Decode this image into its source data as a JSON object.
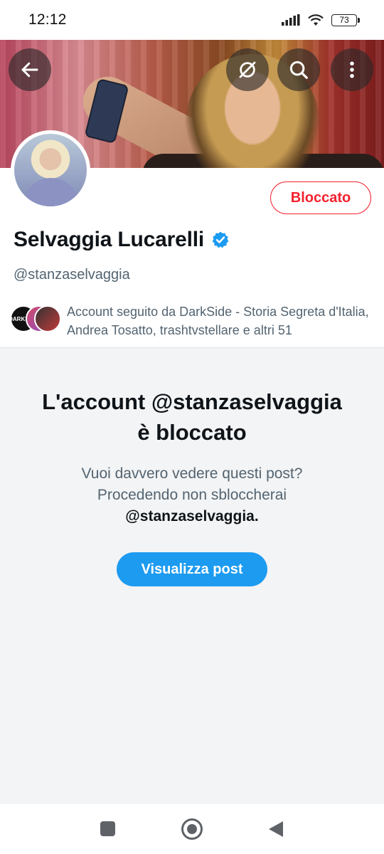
{
  "status_bar": {
    "time": "12:12",
    "battery": "73"
  },
  "header": {
    "back_icon": "arrow-left-icon",
    "grok_icon": "grok-icon",
    "search_icon": "search-icon",
    "more_icon": "more-vertical-icon"
  },
  "profile": {
    "name": "Selvaggia Lucarelli",
    "handle": "@stanzaselvaggia",
    "blocked_label": "Bloccato",
    "followed_by": "Account seguito da DarkSide - Storia Segreta d'Italia, Andrea Tosatto, trashtvstellare e altri 51",
    "verified_color": "#1d9bf0",
    "mini_avatar_1_text": "DARKSIDE"
  },
  "blocked_notice": {
    "title_line1": "L'account @stanzaselvaggia",
    "title_line2": "è bloccato",
    "desc_line1": "Vuoi davvero vedere questi post?",
    "desc_line2": "Procedendo non sbloccherai",
    "desc_handle": "@stanzaselvaggia.",
    "view_button": "Visualizza post"
  },
  "colors": {
    "accent": "#1d9bf0",
    "danger": "#f4212e",
    "muted": "#536471"
  }
}
